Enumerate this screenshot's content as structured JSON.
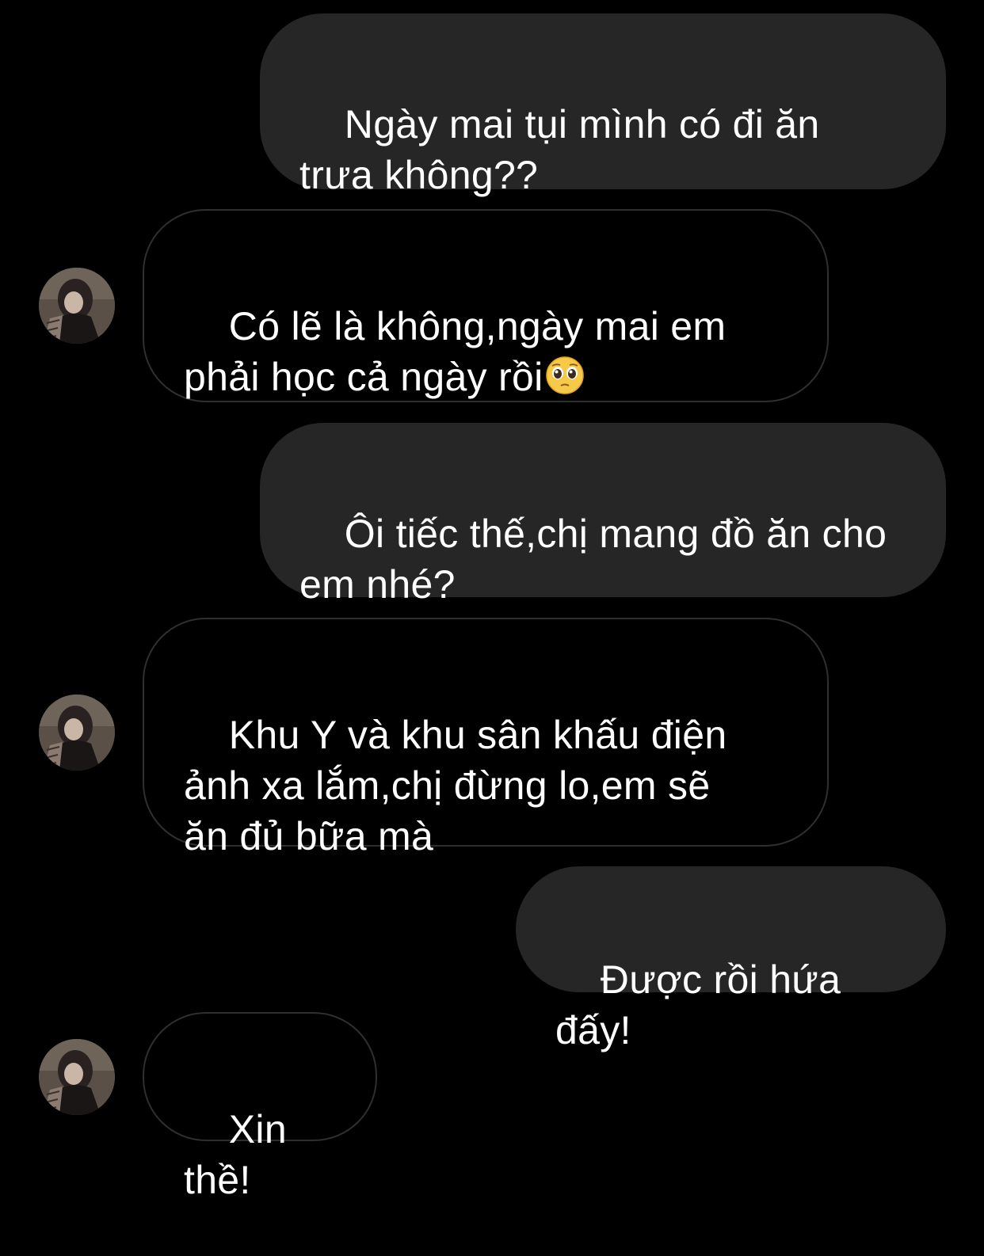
{
  "conversation": {
    "messages": [
      {
        "sender": "me",
        "text": "Ngày mai tụi mình có đi ăn\ntrưa không??"
      },
      {
        "sender": "them",
        "text": "Có lẽ là không,ngày mai em\nphải học cả ngày rồi",
        "emoji": "pleading-face"
      },
      {
        "sender": "me",
        "text": "Ôi tiếc thế,chị mang đồ ăn cho\nem nhé?"
      },
      {
        "sender": "them",
        "text": "Khu Y và khu sân khấu điện\nảnh xa lắm,chị đừng lo,em sẽ\năn đủ bữa mà"
      },
      {
        "sender": "me",
        "text": "Được rồi hứa đấy!"
      },
      {
        "sender": "them",
        "text": "Xin thề!"
      }
    ]
  },
  "colors": {
    "background": "#000000",
    "sent_bubble": "#262626",
    "received_border": "#2f2f2f",
    "text": "#ffffff"
  }
}
